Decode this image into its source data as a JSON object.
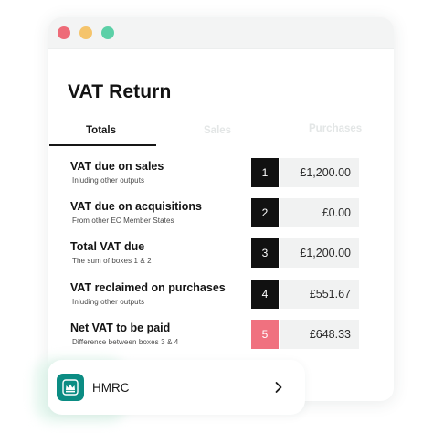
{
  "window": {
    "title": "VAT Return"
  },
  "tabs": [
    {
      "label": "Totals",
      "active": true
    },
    {
      "label": "Sales",
      "active": false
    },
    {
      "label": "Purchases",
      "active": false
    }
  ],
  "rows": [
    {
      "title": "VAT due on sales",
      "subtitle": "Inluding other outputs",
      "box": "1",
      "value": "£1,200.00"
    },
    {
      "title": "VAT due on acquisitions",
      "subtitle": "From other EC Member States",
      "box": "2",
      "value": "£0.00"
    },
    {
      "title": "Total VAT due",
      "subtitle": "The sum of boxes 1 & 2",
      "box": "3",
      "value": "£1,200.00"
    },
    {
      "title": "VAT reclaimed on purchases",
      "subtitle": "Inluding other outputs",
      "box": "4",
      "value": "£551.67"
    },
    {
      "title": "Net VAT to be paid",
      "subtitle": "Difference between boxes 3 & 4",
      "box": "5",
      "value": "£648.33",
      "highlight": true
    }
  ],
  "hmrc": {
    "label": "HMRC",
    "icon": "crown-icon",
    "action_icon": "chevron-right-icon"
  },
  "colors": {
    "box_dark": "#111111",
    "box_highlight": "#f0717f",
    "value_bg": "#f1f2f2",
    "hmrc_brand": "#0b8c83",
    "traffic_red": "#ee6b78",
    "traffic_yellow": "#f5c46b",
    "traffic_green": "#5cd0a7"
  }
}
